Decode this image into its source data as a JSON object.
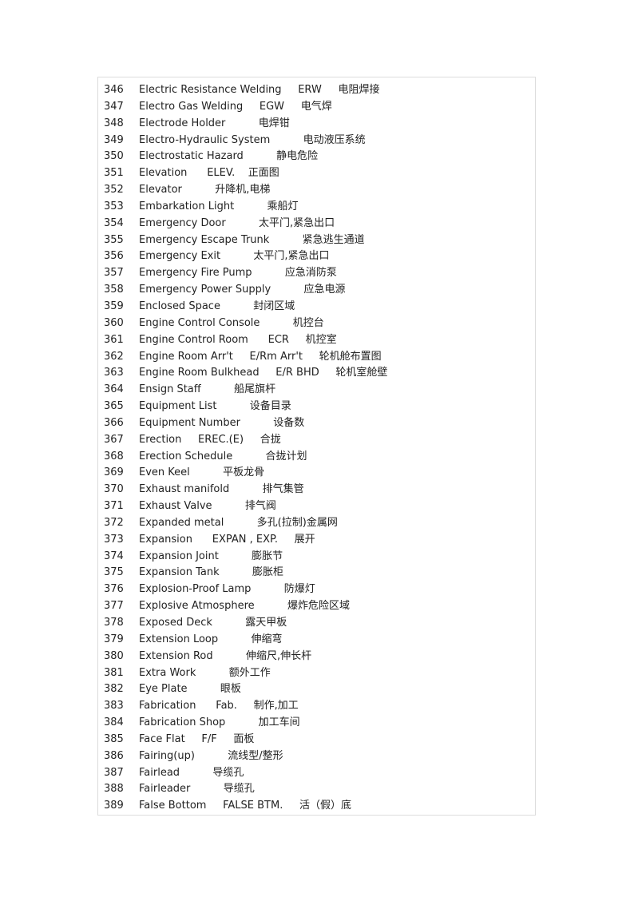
{
  "glossary": {
    "entries": [
      {
        "num": "346",
        "term": "Electric Resistance Welding",
        "abbr": "ERW",
        "zh": "电阻焊接",
        "gap1": "     ",
        "gap2": "     "
      },
      {
        "num": "347",
        "term": "Electro Gas Welding",
        "abbr": "EGW",
        "zh": "电气焊",
        "gap1": "     ",
        "gap2": "     "
      },
      {
        "num": "348",
        "term": "Electrode Holder",
        "abbr": "",
        "zh": "电焊钳",
        "gap1": "          ",
        "gap2": ""
      },
      {
        "num": "349",
        "term": "Electro-Hydraulic System",
        "abbr": "",
        "zh": "电动液压系统",
        "gap1": "          ",
        "gap2": ""
      },
      {
        "num": "350",
        "term": "Electrostatic Hazard",
        "abbr": "",
        "zh": "静电危险",
        "gap1": "          ",
        "gap2": ""
      },
      {
        "num": "351",
        "term": "Elevation",
        "abbr": "ELEV.",
        "zh": "正面图",
        "gap1": "      ",
        "gap2": "    "
      },
      {
        "num": "352",
        "term": "Elevator",
        "abbr": "",
        "zh": "升降机,电梯",
        "gap1": "          ",
        "gap2": ""
      },
      {
        "num": "353",
        "term": "Embarkation Light",
        "abbr": "",
        "zh": "乘船灯",
        "gap1": "          ",
        "gap2": ""
      },
      {
        "num": "354",
        "term": "Emergency Door",
        "abbr": "",
        "zh": "太平门,紧急出口",
        "gap1": "          ",
        "gap2": ""
      },
      {
        "num": "355",
        "term": "Emergency Escape Trunk",
        "abbr": "",
        "zh": "紧急逃生通道",
        "gap1": "          ",
        "gap2": ""
      },
      {
        "num": "356",
        "term": "Emergency Exit",
        "abbr": "",
        "zh": "太平门,紧急出口",
        "gap1": "          ",
        "gap2": ""
      },
      {
        "num": "357",
        "term": "Emergency Fire Pump",
        "abbr": "",
        "zh": "应急消防泵",
        "gap1": "          ",
        "gap2": ""
      },
      {
        "num": "358",
        "term": "Emergency Power Supply",
        "abbr": "",
        "zh": "应急电源",
        "gap1": "          ",
        "gap2": ""
      },
      {
        "num": "359",
        "term": "Enclosed Space",
        "abbr": "",
        "zh": "封闭区域",
        "gap1": "          ",
        "gap2": ""
      },
      {
        "num": "360",
        "term": "Engine Control Console",
        "abbr": "",
        "zh": "机控台",
        "gap1": "          ",
        "gap2": ""
      },
      {
        "num": "361",
        "term": "Engine Control Room",
        "abbr": "ECR",
        "zh": "机控室",
        "gap1": "      ",
        "gap2": "     "
      },
      {
        "num": "362",
        "term": "Engine Room Arr't",
        "abbr": "E/Rm Arr't",
        "zh": "轮机舱布置图",
        "gap1": "     ",
        "gap2": "     "
      },
      {
        "num": "363",
        "term": "Engine Room Bulkhead",
        "abbr": "E/R BHD",
        "zh": "轮机室舱壁",
        "gap1": "     ",
        "gap2": "     "
      },
      {
        "num": "364",
        "term": "Ensign Staff",
        "abbr": "",
        "zh": "船尾旗杆",
        "gap1": "          ",
        "gap2": ""
      },
      {
        "num": "365",
        "term": "Equipment List",
        "abbr": "",
        "zh": "设备目录",
        "gap1": "          ",
        "gap2": ""
      },
      {
        "num": "366",
        "term": "Equipment Number",
        "abbr": "",
        "zh": "设备数",
        "gap1": "          ",
        "gap2": ""
      },
      {
        "num": "367",
        "term": "Erection",
        "abbr": "EREC.(E)",
        "zh": "合拢",
        "gap1": "     ",
        "gap2": "     "
      },
      {
        "num": "368",
        "term": "Erection Schedule",
        "abbr": "",
        "zh": "合拢计划",
        "gap1": "          ",
        "gap2": ""
      },
      {
        "num": "369",
        "term": "Even Keel",
        "abbr": "",
        "zh": "平板龙骨",
        "gap1": "          ",
        "gap2": ""
      },
      {
        "num": "370",
        "term": "Exhaust manifold",
        "abbr": "",
        "zh": "排气集管",
        "gap1": "          ",
        "gap2": ""
      },
      {
        "num": "371",
        "term": "Exhaust Valve",
        "abbr": "",
        "zh": "排气阀",
        "gap1": "          ",
        "gap2": ""
      },
      {
        "num": "372",
        "term": "Expanded metal",
        "abbr": "",
        "zh": "多孔(拉制)金属网",
        "gap1": "          ",
        "gap2": ""
      },
      {
        "num": "373",
        "term": "Expansion",
        "abbr": "EXPAN , EXP.",
        "zh": "展开",
        "gap1": "      ",
        "gap2": "     "
      },
      {
        "num": "374",
        "term": "Expansion Joint",
        "abbr": "",
        "zh": "膨胀节",
        "gap1": "          ",
        "gap2": ""
      },
      {
        "num": "375",
        "term": "Expansion Tank",
        "abbr": "",
        "zh": "膨胀柜",
        "gap1": "          ",
        "gap2": ""
      },
      {
        "num": "376",
        "term": "Explosion-Proof Lamp",
        "abbr": "",
        "zh": "防爆灯",
        "gap1": "          ",
        "gap2": ""
      },
      {
        "num": "377",
        "term": "Explosive Atmosphere",
        "abbr": "",
        "zh": "爆炸危险区域",
        "gap1": "          ",
        "gap2": ""
      },
      {
        "num": "378",
        "term": "Exposed Deck",
        "abbr": "",
        "zh": "露天甲板",
        "gap1": "          ",
        "gap2": ""
      },
      {
        "num": "379",
        "term": "Extension Loop",
        "abbr": "",
        "zh": "伸缩弯",
        "gap1": "          ",
        "gap2": ""
      },
      {
        "num": "380",
        "term": "Extension Rod",
        "abbr": "",
        "zh": "伸缩尺,伸长杆",
        "gap1": "          ",
        "gap2": ""
      },
      {
        "num": "381",
        "term": "Extra Work",
        "abbr": "",
        "zh": "额外工作",
        "gap1": "          ",
        "gap2": ""
      },
      {
        "num": "382",
        "term": "Eye Plate",
        "abbr": "",
        "zh": "眼板",
        "gap1": "          ",
        "gap2": ""
      },
      {
        "num": "383",
        "term": "Fabrication",
        "abbr": "Fab.",
        "zh": "制作,加工",
        "gap1": "      ",
        "gap2": "     "
      },
      {
        "num": "384",
        "term": "Fabrication Shop",
        "abbr": "",
        "zh": "加工车间",
        "gap1": "          ",
        "gap2": ""
      },
      {
        "num": "385",
        "term": "Face Flat",
        "abbr": "F/F",
        "zh": "面板",
        "gap1": "     ",
        "gap2": "     "
      },
      {
        "num": "386",
        "term": "Fairing(up)",
        "abbr": "",
        "zh": "流线型/整形",
        "gap1": "          ",
        "gap2": ""
      },
      {
        "num": "387",
        "term": "Fairlead",
        "abbr": "",
        "zh": "导缆孔",
        "gap1": "          ",
        "gap2": ""
      },
      {
        "num": "388",
        "term": "Fairleader",
        "abbr": "",
        "zh": "导缆孔",
        "gap1": "          ",
        "gap2": ""
      },
      {
        "num": "389",
        "term": "False Bottom",
        "abbr": "FALSE BTM.",
        "zh": "活（假）底",
        "gap1": "     ",
        "gap2": "     "
      }
    ]
  }
}
